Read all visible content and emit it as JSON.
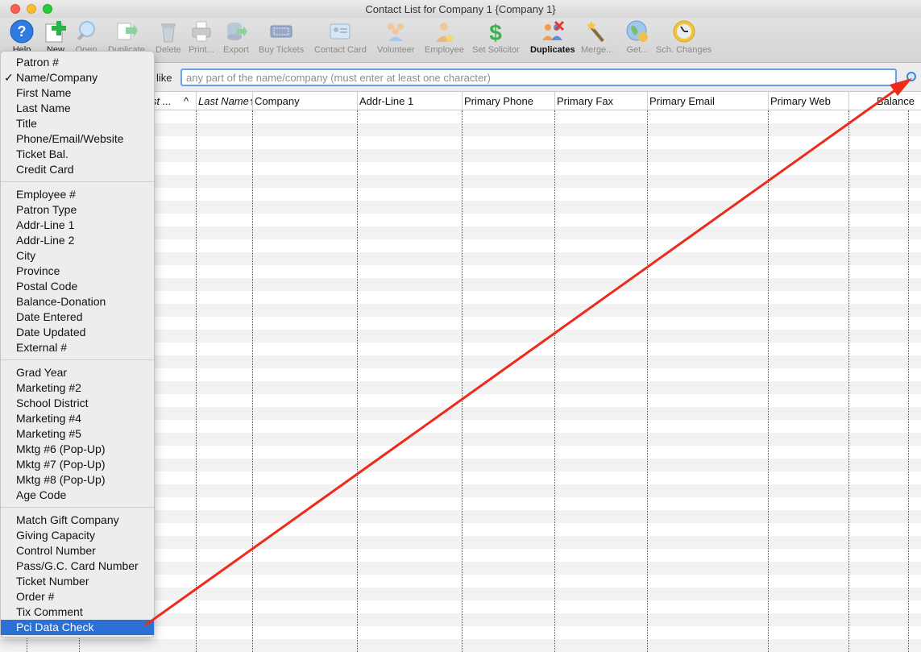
{
  "window": {
    "title": "Contact List for Company 1 {Company 1}"
  },
  "toolbar": {
    "items": [
      {
        "label": "Help",
        "icon": "help-icon"
      },
      {
        "label": "New",
        "icon": "add-icon"
      },
      {
        "label": "Open",
        "icon": "magnifier-icon"
      },
      {
        "label": "Duplicate",
        "icon": "duplicate-icon"
      },
      {
        "label": "Delete",
        "icon": "trash-icon"
      },
      {
        "label": "Print...",
        "icon": "print-icon"
      },
      {
        "label": "Export",
        "icon": "export-icon"
      },
      {
        "label": "Buy Tickets",
        "icon": "ticket-icon"
      },
      {
        "label": "Contact Card",
        "icon": "contact-card-icon"
      },
      {
        "label": "Volunteer",
        "icon": "volunteer-icon"
      },
      {
        "label": "Employee",
        "icon": "employee-icon"
      },
      {
        "label": "Set Solicitor",
        "icon": "dollar-icon"
      },
      {
        "label": "Duplicates",
        "icon": "duplicates-icon"
      },
      {
        "label": "Merge...",
        "icon": "wand-icon"
      },
      {
        "label": "Get...",
        "icon": "globe-icon"
      },
      {
        "label": "Sch. Changes",
        "icon": "clock-icon"
      }
    ]
  },
  "search": {
    "operator_label": "like",
    "placeholder": "any part of the name/company (must enter at least one character)",
    "value": ""
  },
  "table": {
    "columns": [
      {
        "label": "st ..."
      },
      {
        "label": "^"
      },
      {
        "label": "Last Name↑"
      },
      {
        "label": "Company"
      },
      {
        "label": "Addr-Line 1"
      },
      {
        "label": "Primary Phone"
      },
      {
        "label": "Primary Fax"
      },
      {
        "label": "Primary Email"
      },
      {
        "label": "Primary Web"
      },
      {
        "label": "Balance"
      }
    ]
  },
  "menu": {
    "groups": [
      [
        "Patron #",
        "Name/Company",
        "First Name",
        "Last Name",
        "Title",
        "Phone/Email/Website",
        "Ticket Bal.",
        "Credit Card"
      ],
      [
        "Employee #",
        "Patron Type",
        "Addr-Line 1",
        "Addr-Line 2",
        "City",
        "Province",
        "Postal Code",
        "Balance-Donation",
        "Date Entered",
        "Date Updated",
        "External #"
      ],
      [
        "Grad Year",
        "Marketing #2",
        "School District",
        "Marketing #4",
        "Marketing #5",
        "Mktg #6 (Pop-Up)",
        "Mktg #7 (Pop-Up)",
        "Mktg #8 (Pop-Up)",
        "Age Code"
      ],
      [
        "Match Gift Company",
        "Giving Capacity",
        "Control Number",
        "Pass/G.C. Card Number",
        "Ticket Number",
        "Order #",
        "Tix Comment",
        "Pci Data Check"
      ]
    ],
    "checked_item": "Name/Company",
    "highlighted_item": "Pci Data Check",
    "check_glyph": "✓"
  },
  "colors": {
    "highlight": "#2c6fd5",
    "annotation_arrow": "#ee2a1b",
    "search_focus": "#6aa0e8"
  }
}
